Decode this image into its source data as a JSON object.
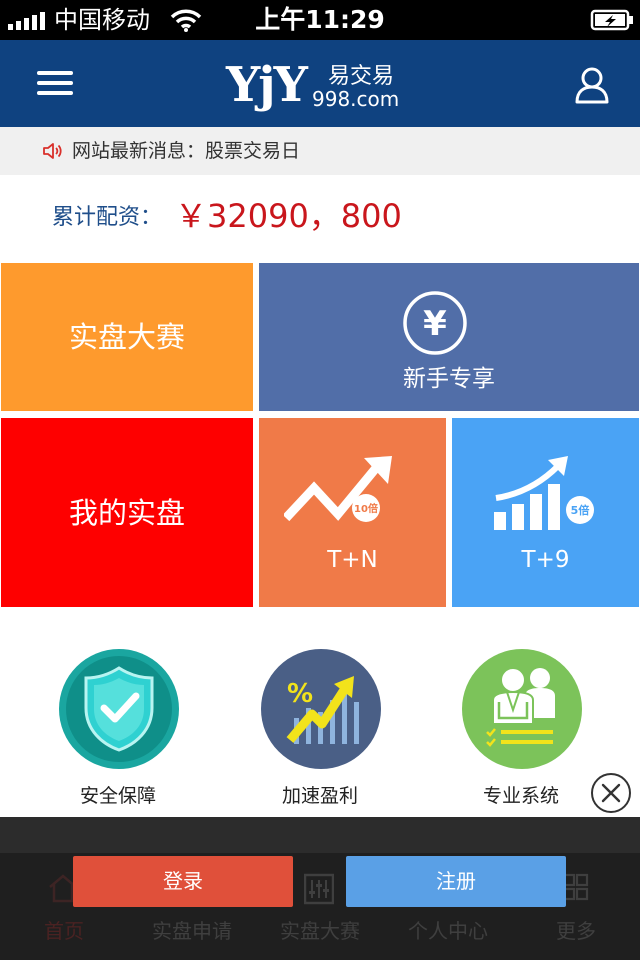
{
  "status_bar": {
    "carrier": "中国移动",
    "time": "上午11:29"
  },
  "header": {
    "logo_mark": "YjY",
    "logo_cn": "易交易",
    "logo_domain": "998.com"
  },
  "news": {
    "text": "网站最新消息：股票交易日"
  },
  "funding": {
    "label": "累计配资：",
    "value": "￥32090，800"
  },
  "tiles": {
    "contest": "实盘大赛",
    "newbie": "新手专享",
    "newbie_icon_symbol": "¥",
    "my_account": "我的实盘",
    "tn": "T+N",
    "tn_badge": "10倍",
    "t9": "T+9",
    "t9_badge": "5倍"
  },
  "features": [
    {
      "label": "安全保障",
      "icon": "shield-check-icon",
      "color": "#1aa6a0"
    },
    {
      "label": "加速盈利",
      "icon": "growth-arrow-icon",
      "color": "#4a5f86"
    },
    {
      "label": "专业系统",
      "icon": "team-checklist-icon",
      "color": "#7cc35a"
    }
  ],
  "actions": {
    "login": "登录",
    "register": "注册"
  },
  "tabs": [
    {
      "label": "首页",
      "icon": "home-icon"
    },
    {
      "label": "实盘申请",
      "icon": "apply-icon"
    },
    {
      "label": "实盘大赛",
      "icon": "sliders-icon"
    },
    {
      "label": "个人中心",
      "icon": "person-icon"
    },
    {
      "label": "更多",
      "icon": "grid-icon"
    }
  ],
  "colors": {
    "header": "#0f4280",
    "contest_tile": "#fe9a2d",
    "newbie_tile": "#516ea8",
    "my_account_tile": "#fe0000",
    "tn_tile": "#f07a48",
    "t9_tile": "#4aa3f5",
    "funding_value": "#c9161c",
    "login_button": "#e0503a",
    "register_button": "#5aa0e6"
  }
}
